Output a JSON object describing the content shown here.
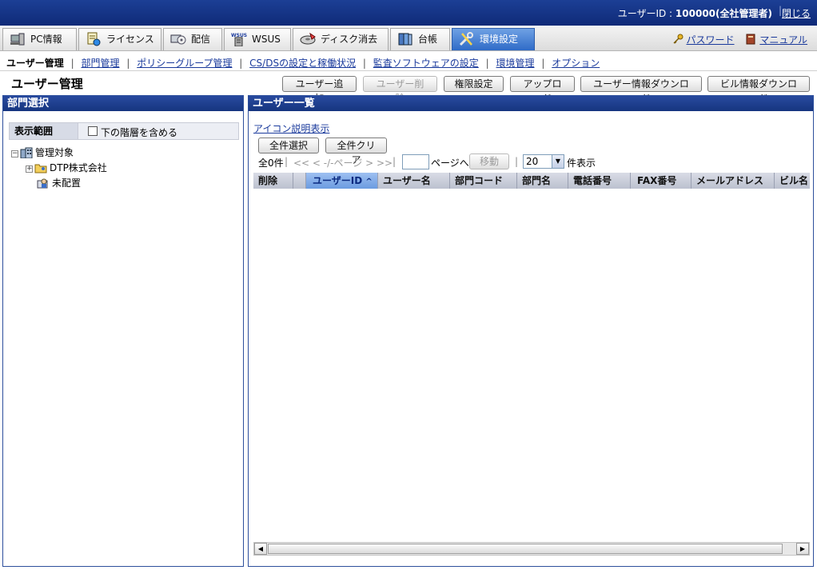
{
  "header": {
    "user_label": "ユーザーID : ",
    "user_value": "100000(全社管理者)",
    "close_link": "閉じる"
  },
  "tabs": [
    {
      "label": "PC情報",
      "icon": "pc-icon"
    },
    {
      "label": "ライセンス",
      "icon": "license-icon"
    },
    {
      "label": "配信",
      "icon": "delivery-icon"
    },
    {
      "label": "WSUS",
      "icon": "wsus-icon"
    },
    {
      "label": "ディスク消去",
      "icon": "disk-erase-icon"
    },
    {
      "label": "台帳",
      "icon": "ledger-icon"
    },
    {
      "label": "環境設定",
      "icon": "settings-tools-icon",
      "active": true
    }
  ],
  "top_links": {
    "password": "パスワード",
    "manual": "マニュアル"
  },
  "subnav": {
    "current": "ユーザー管理",
    "links": [
      "部門管理",
      "ポリシーグループ管理",
      "CS/DSの設定と稼働状況",
      "監査ソフトウェアの設定",
      "環境管理",
      "オプション"
    ]
  },
  "page": {
    "title": "ユーザー管理",
    "buttons": {
      "add_user": "ユーザー追加",
      "delete_user": "ユーザー削除",
      "permission": "権限設定",
      "upload": "アップロード",
      "download_user": "ユーザー情報ダウンロード",
      "download_building": "ビル情報ダウンロード"
    }
  },
  "left_panel": {
    "title": "部門選択",
    "scope_label": "表示範囲",
    "include_lower": "下の階層を含める",
    "tree": {
      "root": "管理対象",
      "company": "DTP株式会社",
      "unassigned": "未配置"
    }
  },
  "right_panel": {
    "title": "ユーザー一覧",
    "icon_legend": "アイコン説明表示",
    "select_all": "全件選択",
    "clear_all": "全件クリア",
    "pager": {
      "count": "全0件",
      "nav": "<< < -/-ページ > >>",
      "page_to": "ページへ",
      "move": "移動",
      "per_page_value": "20",
      "per_page_suffix": "件表示"
    },
    "columns": [
      "削除",
      "",
      "ユーザーID",
      "ユーザー名",
      "部門コード",
      "部門名",
      "電話番号",
      "FAX番号",
      "メールアドレス",
      "ビル名"
    ],
    "sort_indicator": "^"
  },
  "colors": {
    "header_blue": "#1c3f95",
    "active_tab": "#2f6bc7",
    "link": "#1a3a9c"
  }
}
